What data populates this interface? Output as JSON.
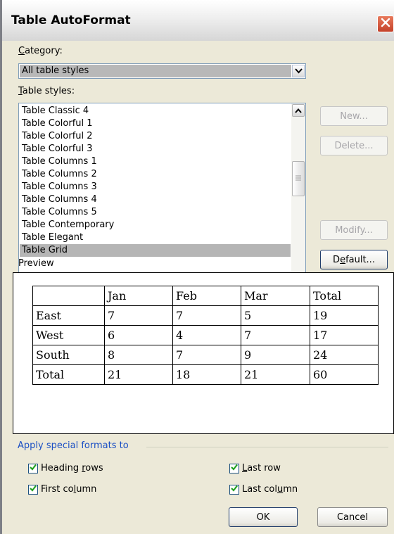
{
  "window": {
    "title": "Table AutoFormat"
  },
  "category": {
    "label_key": "C",
    "label_rest": "ategory:",
    "selected": "All table styles"
  },
  "styles": {
    "label_key": "T",
    "label_rest": "able styles:",
    "items": [
      "Table Classic 4",
      "Table Colorful 1",
      "Table Colorful 2",
      "Table Colorful 3",
      "Table Columns 1",
      "Table Columns 2",
      "Table Columns 3",
      "Table Columns 4",
      "Table Columns 5",
      "Table Contemporary",
      "Table Elegant",
      "Table Grid"
    ],
    "selected_index": 11
  },
  "buttons": {
    "new": "New...",
    "delete": "Delete...",
    "modify": "Modify...",
    "default_pre": "D",
    "default_key": "e",
    "default_post": "fault...",
    "ok": "OK",
    "cancel": "Cancel"
  },
  "preview": {
    "label": "Preview",
    "table": [
      [
        "",
        "Jan",
        "Feb",
        "Mar",
        "Total"
      ],
      [
        "East",
        "7",
        "7",
        "5",
        "19"
      ],
      [
        "West",
        "6",
        "4",
        "7",
        "17"
      ],
      [
        "South",
        "8",
        "7",
        "9",
        "24"
      ],
      [
        "Total",
        "21",
        "18",
        "21",
        "60"
      ]
    ]
  },
  "special": {
    "title": "Apply special formats to",
    "heading_rows_pre": "Heading ",
    "heading_rows_key": "r",
    "heading_rows_post": "ows",
    "first_column_pre": "First co",
    "first_column_key": "l",
    "first_column_post": "umn",
    "last_row_pre": "",
    "last_row_key": "L",
    "last_row_post": "ast row",
    "last_column_pre": "Last col",
    "last_column_key": "u",
    "last_column_post": "mn",
    "heading_rows_checked": true,
    "first_column_checked": true,
    "last_row_checked": true,
    "last_column_checked": true
  },
  "colors": {
    "group_title": "#1a4fc4",
    "checkmark": "#21a121",
    "close": "#c4412a"
  },
  "icons": [
    "close-icon",
    "chevron-down-icon",
    "scroll-up-icon",
    "scroll-down-icon",
    "scroll-grip-icon",
    "checkmark-icon"
  ]
}
